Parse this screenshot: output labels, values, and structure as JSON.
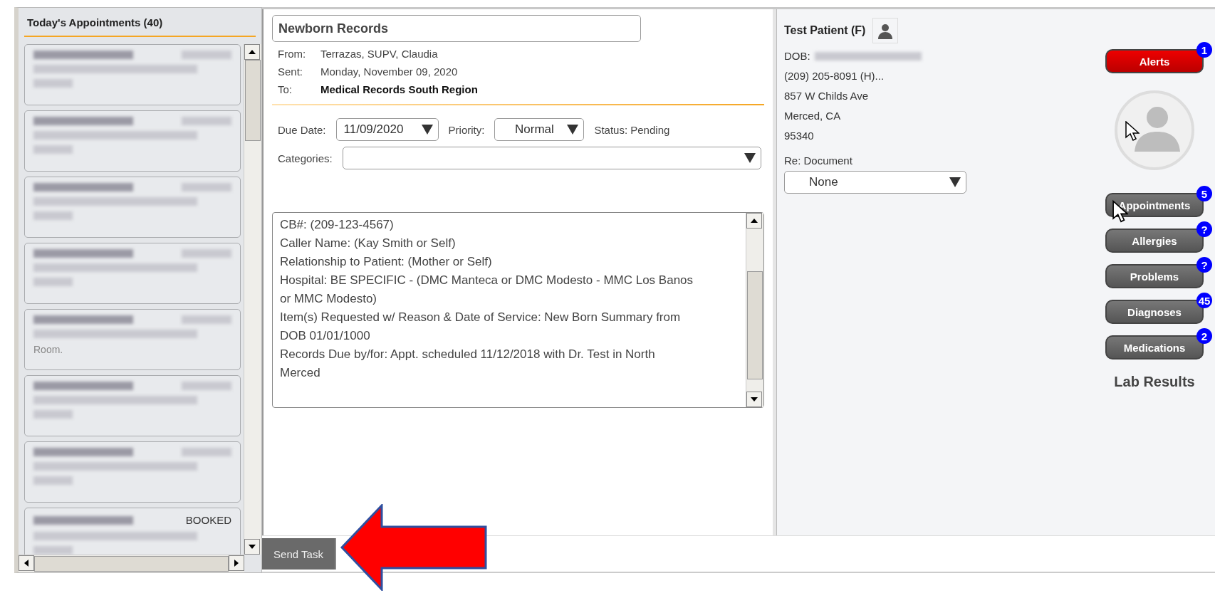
{
  "appointments": {
    "title": "Today's Appointments (40)",
    "cards": [
      {
        "redacted": true
      },
      {
        "redacted": true
      },
      {
        "redacted": true
      },
      {
        "redacted": true
      },
      {
        "redacted": true,
        "note": "Room."
      },
      {
        "redacted": true
      },
      {
        "redacted": true
      },
      {
        "redacted": true,
        "status": "BOOKED"
      }
    ]
  },
  "task": {
    "title": "Newborn Records",
    "header": [
      {
        "label": "From:",
        "value": "Terrazas, SUPV, Claudia",
        "bold": false
      },
      {
        "label": "Sent:",
        "value": "Monday, November 09, 2020",
        "bold": false
      },
      {
        "label": "To:",
        "value": "Medical Records South Region",
        "bold": true
      }
    ],
    "due_date": {
      "label": "Due Date:",
      "value": "11/09/2020"
    },
    "priority": {
      "label": "Priority:",
      "value": "Normal"
    },
    "status": {
      "label": "Status:",
      "value": "Pending"
    },
    "categories": {
      "label": "Categories:"
    },
    "body": [
      "CB#: (209-123-4567)",
      "Caller Name: (Kay Smith or Self)",
      "Relationship to Patient: (Mother or Self)",
      "Hospital: BE SPECIFIC - (DMC Manteca or DMC Modesto - MMC Los Banos or MMC Modesto)",
      "Item(s) Requested w/ Reason & Date of Service: New Born Summary from DOB 01/01/1000",
      "Records Due by/for: Appt. scheduled 11/12/2018 with Dr. Test in North Merced"
    ]
  },
  "patient": {
    "name": "Test Patient (F)",
    "dob_label": "DOB:",
    "phone": "(209) 205-8091 (H)...",
    "address": [
      "857 W Childs Ave",
      "Merced, CA",
      "95340"
    ],
    "re_document": {
      "label": "Re: Document",
      "value": "None"
    }
  },
  "side_buttons": [
    {
      "label": "Alerts",
      "badge": "1",
      "kind": "alert"
    },
    {
      "label": "Appointments",
      "badge": "5",
      "kind": "nav"
    },
    {
      "label": "Allergies",
      "badge": "?",
      "kind": "nav"
    },
    {
      "label": "Problems",
      "badge": "?",
      "kind": "nav"
    },
    {
      "label": "Diagnoses",
      "badge": "45",
      "kind": "nav"
    },
    {
      "label": "Medications",
      "badge": "2",
      "kind": "nav"
    }
  ],
  "lab_results": "Lab Results",
  "footer": {
    "send_task": "Send Task"
  }
}
